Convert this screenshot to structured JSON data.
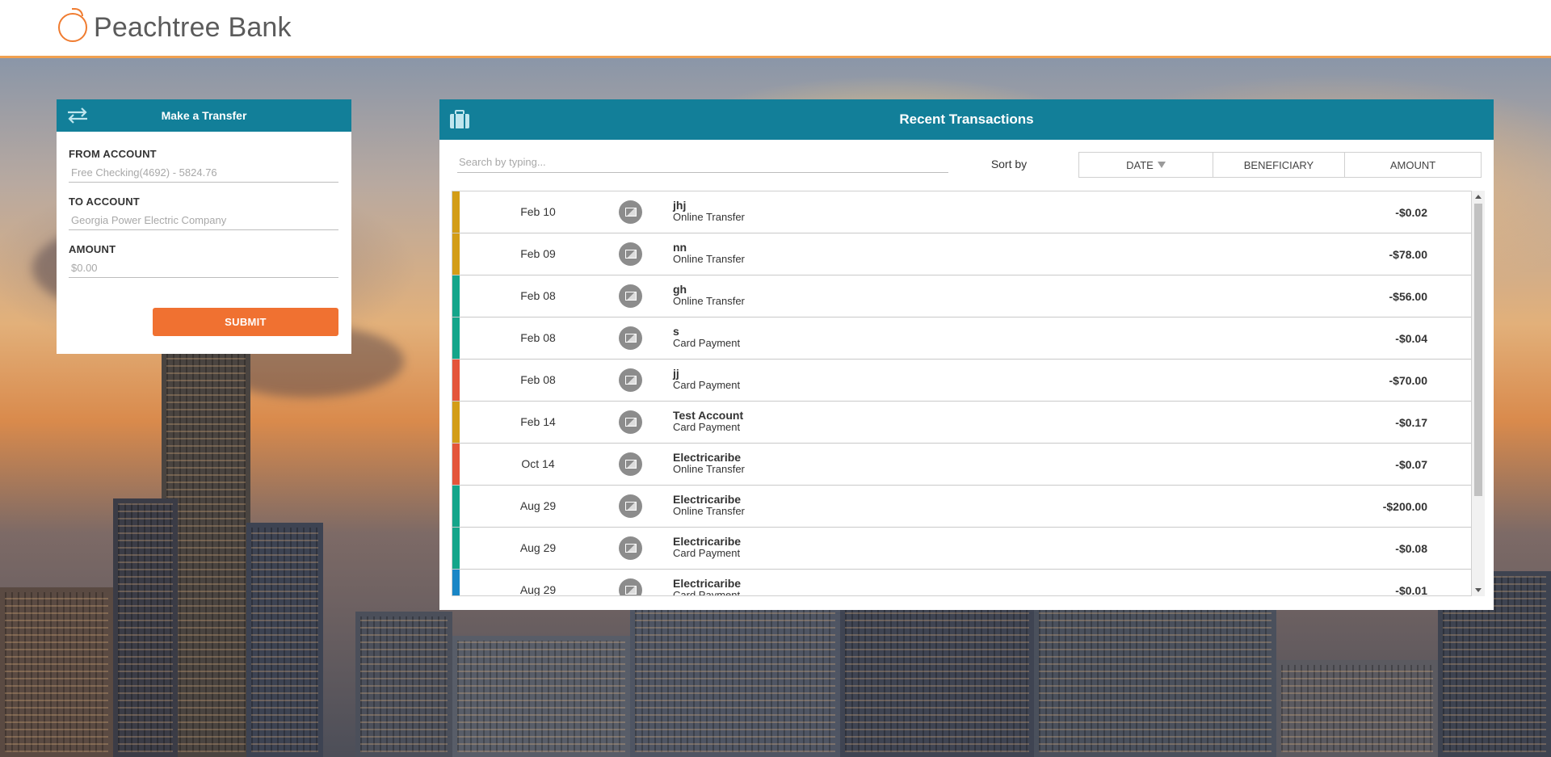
{
  "header": {
    "brand_name": "Peachtree Bank"
  },
  "transfer": {
    "title": "Make a Transfer",
    "from_label": "FROM ACCOUNT",
    "from_value": "Free Checking(4692) - 5824.76",
    "to_label": "TO ACCOUNT",
    "to_value": "Georgia Power Electric Company",
    "amount_label": "AMOUNT",
    "amount_placeholder": "$0.00",
    "submit_label": "SUBMIT"
  },
  "transactions": {
    "title": "Recent Transactions",
    "search_placeholder": "Search by typing...",
    "sort_by_label": "Sort by",
    "sort_options": [
      "DATE",
      "BENEFICIARY",
      "AMOUNT"
    ],
    "rows": [
      {
        "date": "Feb 10",
        "beneficiary": "jhj",
        "type": "Online Transfer",
        "amount": "-$0.02",
        "color": "#d39d17"
      },
      {
        "date": "Feb 09",
        "beneficiary": "nn",
        "type": "Online Transfer",
        "amount": "-$78.00",
        "color": "#d39d17"
      },
      {
        "date": "Feb 08",
        "beneficiary": "gh",
        "type": "Online Transfer",
        "amount": "-$56.00",
        "color": "#14a58a"
      },
      {
        "date": "Feb 08",
        "beneficiary": "s",
        "type": "Card Payment",
        "amount": "-$0.04",
        "color": "#14a58a"
      },
      {
        "date": "Feb 08",
        "beneficiary": "jj",
        "type": "Card Payment",
        "amount": "-$70.00",
        "color": "#e4553a"
      },
      {
        "date": "Feb 14",
        "beneficiary": "Test Account",
        "type": "Card Payment",
        "amount": "-$0.17",
        "color": "#d39d17"
      },
      {
        "date": "Oct 14",
        "beneficiary": "Electricaribe",
        "type": "Online Transfer",
        "amount": "-$0.07",
        "color": "#e4553a"
      },
      {
        "date": "Aug 29",
        "beneficiary": "Electricaribe",
        "type": "Online Transfer",
        "amount": "-$200.00",
        "color": "#14a58a"
      },
      {
        "date": "Aug 29",
        "beneficiary": "Electricaribe",
        "type": "Card Payment",
        "amount": "-$0.08",
        "color": "#14a58a"
      },
      {
        "date": "Aug 29",
        "beneficiary": "Electricaribe",
        "type": "Card Payment",
        "amount": "-$0.01",
        "color": "#1a86c6"
      }
    ]
  },
  "colors": {
    "primary": "#127f99",
    "accent": "#f07131",
    "header_border": "#f0a050"
  },
  "icons": {
    "brand": "peach-icon",
    "transfer": "swap-arrows-icon",
    "transactions": "briefcase-icon",
    "row_avatar": "image-placeholder-icon"
  }
}
